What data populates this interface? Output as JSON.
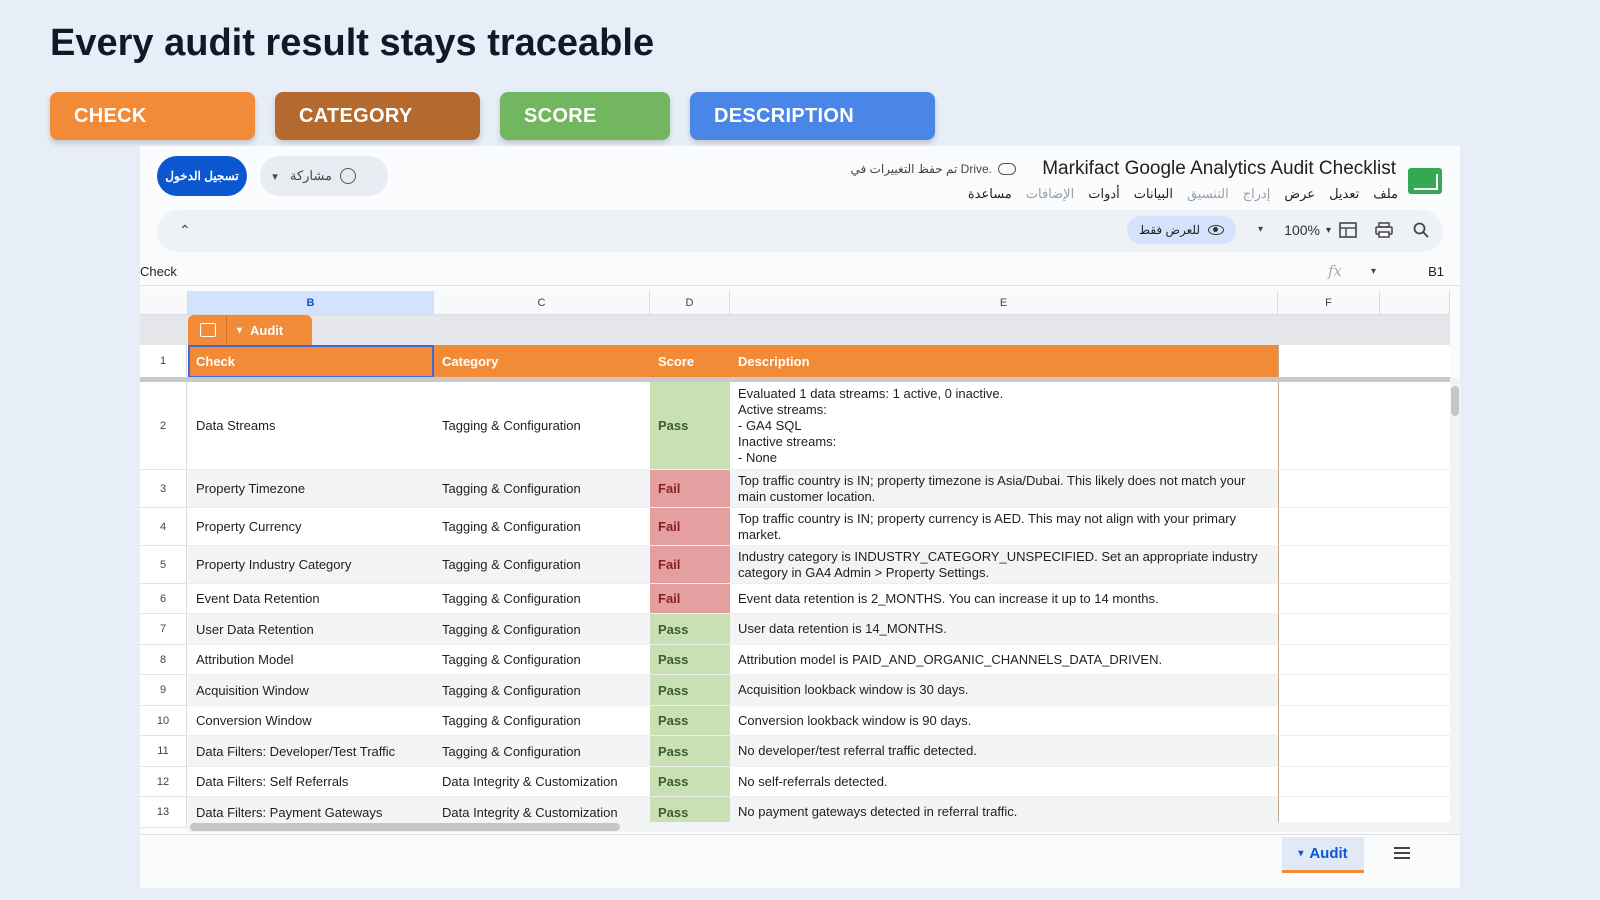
{
  "headline": "Every audit result stays traceable",
  "legend": {
    "check": "CHECK",
    "category": "CATEGORY",
    "score": "SCORE",
    "description": "DESCRIPTION",
    "colors": {
      "check": "#f28b37",
      "category": "#b46a2e",
      "score": "#72b760",
      "description": "#4a86e8"
    }
  },
  "app": {
    "doc_title": "Markifact Google Analytics Audit Checklist",
    "saved_status": "تم حفظ التغييرات في Drive.",
    "menu": [
      {
        "label": "ملف",
        "dim": false
      },
      {
        "label": "تعديل",
        "dim": false
      },
      {
        "label": "عرض",
        "dim": false
      },
      {
        "label": "إدراج",
        "dim": true
      },
      {
        "label": "التنسيق",
        "dim": true
      },
      {
        "label": "البيانات",
        "dim": false
      },
      {
        "label": "أدوات",
        "dim": false
      },
      {
        "label": "الإضافات",
        "dim": true
      },
      {
        "label": "مساعدة",
        "dim": false
      }
    ],
    "signin_label": "تسجيل الدخول",
    "share_label": "مشاركة",
    "view_only_label": "للعرض فقط",
    "zoom": "100%",
    "formula_content": "Check",
    "name_box": "B1",
    "fx": "fx",
    "columns": [
      "B",
      "C",
      "D",
      "E",
      "F"
    ],
    "table_name": "Audit",
    "sheet_tab": "Audit"
  },
  "table": {
    "headers": {
      "check": "Check",
      "category": "Category",
      "score": "Score",
      "description": "Description"
    },
    "rows": [
      {
        "n": "2",
        "check": "Data Streams",
        "category": "Tagging & Configuration",
        "score": "Pass",
        "description": "Evaluated 1 data streams: 1 active, 0 inactive.\nActive streams:\n- GA4 SQL\nInactive streams:\n- None"
      },
      {
        "n": "3",
        "check": "Property Timezone",
        "category": "Tagging & Configuration",
        "score": "Fail",
        "description": "Top traffic country is IN; property timezone is Asia/Dubai. This likely does not match your main customer location."
      },
      {
        "n": "4",
        "check": "Property Currency",
        "category": "Tagging & Configuration",
        "score": "Fail",
        "description": "Top traffic country is IN; property currency is AED. This may not align with your primary market."
      },
      {
        "n": "5",
        "check": "Property Industry Category",
        "category": "Tagging & Configuration",
        "score": "Fail",
        "description": "Industry category is INDUSTRY_CATEGORY_UNSPECIFIED. Set an appropriate industry category in GA4 Admin > Property Settings."
      },
      {
        "n": "6",
        "check": "Event Data Retention",
        "category": "Tagging & Configuration",
        "score": "Fail",
        "description": "Event data retention is 2_MONTHS. You can increase it up to 14 months."
      },
      {
        "n": "7",
        "check": "User Data Retention",
        "category": "Tagging & Configuration",
        "score": "Pass",
        "description": "User data retention is 14_MONTHS."
      },
      {
        "n": "8",
        "check": "Attribution Model",
        "category": "Tagging & Configuration",
        "score": "Pass",
        "description": "Attribution model is PAID_AND_ORGANIC_CHANNELS_DATA_DRIVEN."
      },
      {
        "n": "9",
        "check": "Acquisition Window",
        "category": "Tagging & Configuration",
        "score": "Pass",
        "description": "Acquisition lookback window is 30 days."
      },
      {
        "n": "10",
        "check": "Conversion Window",
        "category": "Tagging & Configuration",
        "score": "Pass",
        "description": "Conversion lookback window is 90 days."
      },
      {
        "n": "11",
        "check": "Data Filters: Developer/Test Traffic",
        "category": "Tagging & Configuration",
        "score": "Pass",
        "description": "No developer/test referral traffic detected."
      },
      {
        "n": "12",
        "check": "Data Filters: Self Referrals",
        "category": "Data Integrity & Customization",
        "score": "Pass",
        "description": "No self-referrals detected."
      },
      {
        "n": "13",
        "check": "Data Filters: Payment Gateways",
        "category": "Data Integrity & Customization",
        "score": "Pass",
        "description": "No payment gateways detected in referral traffic."
      }
    ]
  }
}
